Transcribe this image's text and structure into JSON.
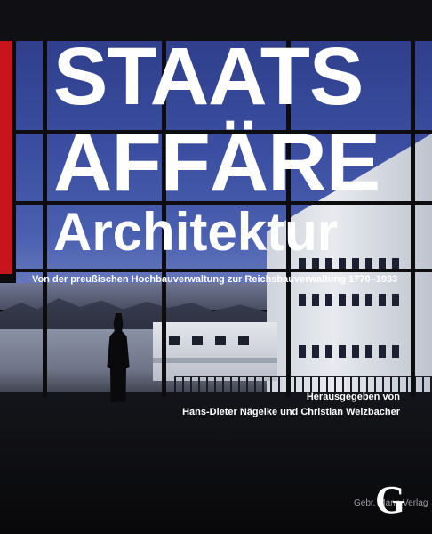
{
  "cover": {
    "title_line1": "STAATS",
    "title_line2": "AFFÄRE",
    "title_line3": "Architektur",
    "subtitle": "Von der preußischen Hochbauverwaltung zur Reichsbauverwaltung 1770–1933",
    "editors_line1": "Herausgegeben von",
    "editors_line2": "Hans-Dieter Nägelke und Christian Welzbacher",
    "publisher_logo_letter": "G",
    "publisher_name": "Gebr. Mann Verlag"
  },
  "colors": {
    "accent_red": "#c8141c",
    "sky_blue": "#3a4da0",
    "text": "#ffffff"
  }
}
